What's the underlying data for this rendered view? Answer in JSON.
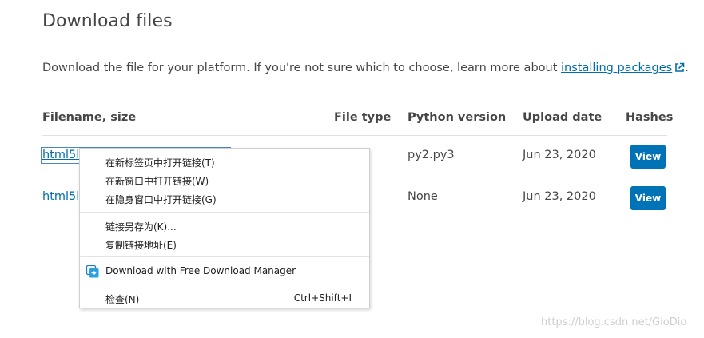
{
  "page": {
    "title": "Download files",
    "description_before": "Download the file for your platform. If you're not sure which to choose, learn more about ",
    "description_link": "installing packages",
    "description_after": "."
  },
  "table": {
    "headers": {
      "filename": "Filename, size",
      "file_type": "File type",
      "python_version": "Python version",
      "upload_date": "Upload date",
      "hashes": "Hashes"
    },
    "rows": [
      {
        "filename_visible": "html5li",
        "python_version": "py2.py3",
        "upload_date": "Jun 23, 2020",
        "view_label": "View"
      },
      {
        "filename_visible": "html5li",
        "python_version": "None",
        "upload_date": "Jun 23, 2020",
        "view_label": "View"
      }
    ]
  },
  "context_menu": {
    "open_new_tab": "在新标签页中打开链接(T)",
    "open_new_window": "在新窗口中打开链接(W)",
    "open_incognito": "在隐身窗口中打开链接(G)",
    "save_link_as": "链接另存为(K)...",
    "copy_link": "复制链接地址(E)",
    "fdm_download": "Download with Free Download Manager",
    "inspect": "检查(N)",
    "inspect_shortcut": "Ctrl+Shift+I"
  },
  "watermark": "https://blog.csdn.net/GioDio",
  "colors": {
    "link": "#006dad",
    "button": "#0073b7",
    "text": "#464646"
  },
  "icons": [
    "external-link-icon",
    "fdm-icon"
  ]
}
